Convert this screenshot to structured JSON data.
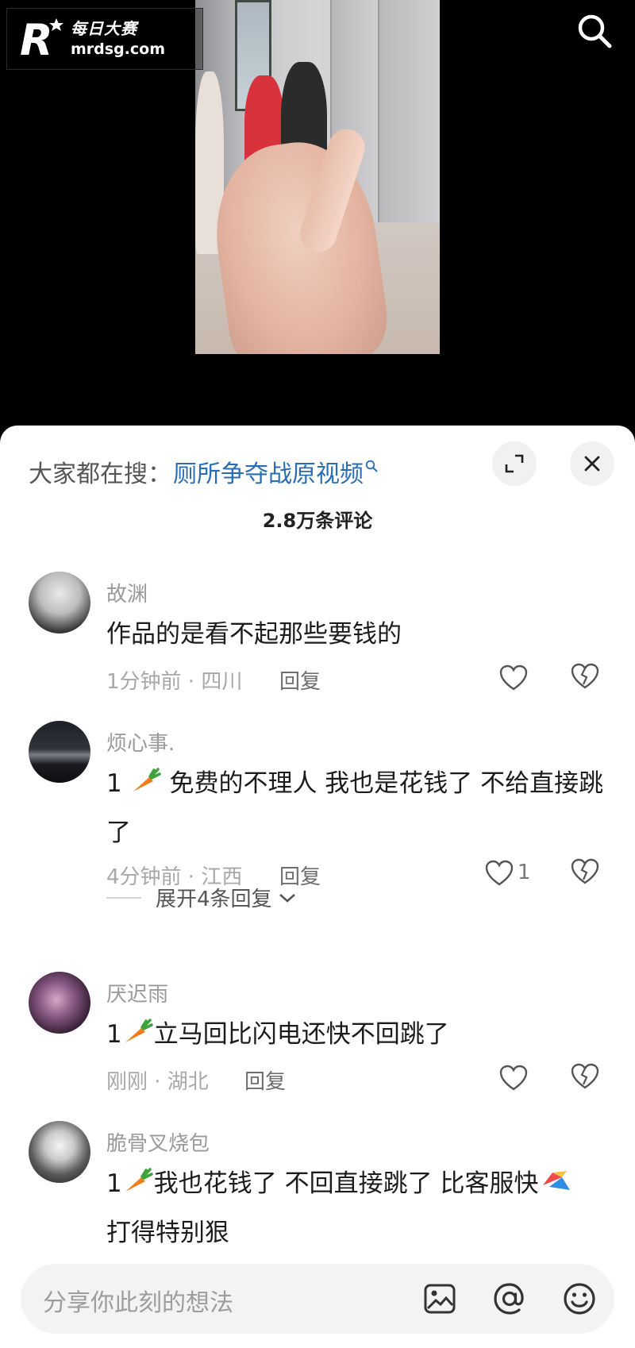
{
  "watermark": {
    "logo_letter": "R",
    "brand_cn": "每日大赛",
    "url": "mrdsg.com"
  },
  "icons": {
    "search": "search-icon",
    "expand": "expand-icon",
    "close": "close-icon",
    "image": "image-icon",
    "at": "at-icon",
    "emoji": "emoji-icon",
    "heart": "heart-icon",
    "broken_heart": "broken-heart-icon",
    "carrot": "carrot-emoji-icon",
    "chevron": "chevron-down-icon"
  },
  "colors": {
    "keyword": "#2a6db5",
    "sheet_bg": "#ffffff",
    "carrot": "#f07d1a"
  },
  "sheet": {
    "hot_search_label": "大家都在搜：",
    "hot_search_keyword": "厕所争夺战原视频",
    "comment_count_title": "2.8万条评论"
  },
  "comments": [
    {
      "user": "故渊",
      "text": "作品的是看不起那些要钱的",
      "time": "1分钟前",
      "location": "四川",
      "meta": "1分钟前 · 四川",
      "reply_label": "回复",
      "likes": ""
    },
    {
      "user": "烦心事.",
      "text_prefix": "1",
      "text": "免费的不理人 我也是花钱了 不给直接跳了",
      "time": "4分钟前",
      "location": "江西",
      "meta": "4分钟前 · 江西",
      "reply_label": "回复",
      "likes": "1",
      "expand_replies": "展开4条回复"
    },
    {
      "user": "厌迟雨",
      "text_prefix": "1",
      "text": "立马回比闪电还快不回跳了",
      "time": "刚刚",
      "location": "湖北",
      "meta": "刚刚 · 湖北",
      "reply_label": "回复",
      "likes": ""
    },
    {
      "user": "脆骨叉烧包",
      "text_prefix": "1",
      "text": "我也花钱了 不回直接跳了 比客服快",
      "text_suffix": "打得特别狠"
    }
  ],
  "input": {
    "placeholder": "分享你此刻的想法"
  }
}
